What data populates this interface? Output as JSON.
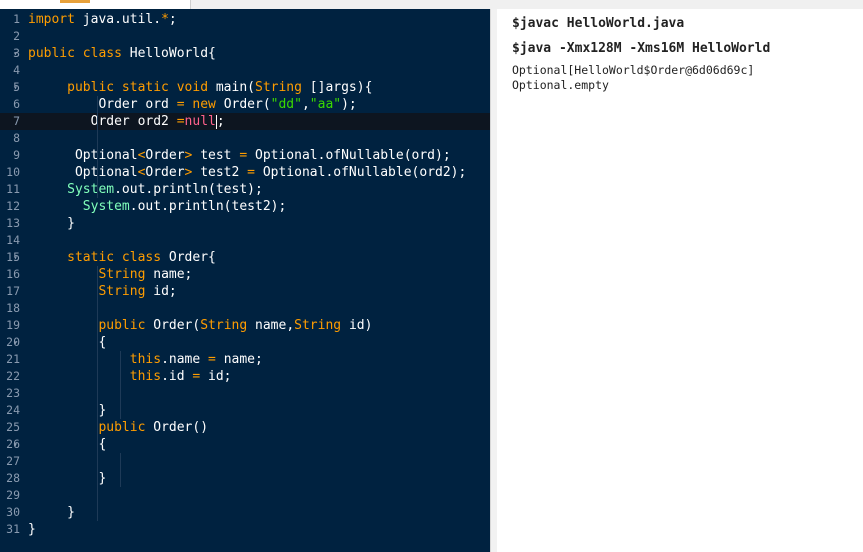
{
  "editor": {
    "lines": [
      {
        "n": "1",
        "fold": false,
        "segs": [
          {
            "t": "import ",
            "c": "kw"
          },
          {
            "t": "java.util.",
            "c": "ident"
          },
          {
            "t": "*",
            "c": "op"
          },
          {
            "t": ";",
            "c": "ident"
          }
        ]
      },
      {
        "n": "2",
        "fold": false,
        "segs": []
      },
      {
        "n": "3",
        "fold": true,
        "segs": [
          {
            "t": "public class ",
            "c": "kw"
          },
          {
            "t": "HelloWorld{",
            "c": "ident"
          }
        ]
      },
      {
        "n": "4",
        "fold": false,
        "segs": []
      },
      {
        "n": "5",
        "fold": true,
        "segs": [
          {
            "t": "     ",
            "c": "ident"
          },
          {
            "t": "public static void ",
            "c": "kw"
          },
          {
            "t": "main(",
            "c": "ident"
          },
          {
            "t": "String",
            "c": "kw"
          },
          {
            "t": " []args){",
            "c": "ident"
          }
        ]
      },
      {
        "n": "6",
        "fold": false,
        "segs": [
          {
            "t": "         Order ord ",
            "c": "ident"
          },
          {
            "t": "= ",
            "c": "op"
          },
          {
            "t": "new ",
            "c": "kw"
          },
          {
            "t": "Order(",
            "c": "ident"
          },
          {
            "t": "\"dd\"",
            "c": "str"
          },
          {
            "t": ",",
            "c": "ident"
          },
          {
            "t": "\"aa\"",
            "c": "str"
          },
          {
            "t": ");",
            "c": "ident"
          }
        ]
      },
      {
        "n": "7",
        "fold": false,
        "active": true,
        "segs": [
          {
            "t": "        Order ord2 ",
            "c": "ident"
          },
          {
            "t": "=",
            "c": "op"
          },
          {
            "t": "null",
            "c": "nul"
          },
          {
            "t": ";",
            "c": "ident",
            "cursor": true
          }
        ]
      },
      {
        "n": "8",
        "fold": false,
        "segs": []
      },
      {
        "n": "9",
        "fold": false,
        "segs": [
          {
            "t": "      Optional",
            "c": "ident"
          },
          {
            "t": "<",
            "c": "op"
          },
          {
            "t": "Order",
            "c": "ident"
          },
          {
            "t": ">",
            "c": "op"
          },
          {
            "t": " test ",
            "c": "ident"
          },
          {
            "t": "= ",
            "c": "op"
          },
          {
            "t": "Optional.ofNullable(ord);",
            "c": "ident"
          }
        ]
      },
      {
        "n": "10",
        "fold": false,
        "segs": [
          {
            "t": "      Optional",
            "c": "ident"
          },
          {
            "t": "<",
            "c": "op"
          },
          {
            "t": "Order",
            "c": "ident"
          },
          {
            "t": ">",
            "c": "op"
          },
          {
            "t": " test2 ",
            "c": "ident"
          },
          {
            "t": "= ",
            "c": "op"
          },
          {
            "t": "Optional.ofNullable(ord2);",
            "c": "ident"
          }
        ]
      },
      {
        "n": "11",
        "fold": false,
        "segs": [
          {
            "t": "     ",
            "c": "ident"
          },
          {
            "t": "System",
            "c": "ty"
          },
          {
            "t": ".out.println(test);",
            "c": "ident"
          }
        ]
      },
      {
        "n": "12",
        "fold": false,
        "segs": [
          {
            "t": "       ",
            "c": "ident"
          },
          {
            "t": "System",
            "c": "ty"
          },
          {
            "t": ".out.println(test2);",
            "c": "ident"
          }
        ]
      },
      {
        "n": "13",
        "fold": false,
        "segs": [
          {
            "t": "     }",
            "c": "ident"
          }
        ]
      },
      {
        "n": "14",
        "fold": false,
        "segs": []
      },
      {
        "n": "15",
        "fold": true,
        "segs": [
          {
            "t": "     ",
            "c": "ident"
          },
          {
            "t": "static class ",
            "c": "kw"
          },
          {
            "t": "Order{",
            "c": "ident"
          }
        ]
      },
      {
        "n": "16",
        "fold": false,
        "segs": [
          {
            "t": "         ",
            "c": "ident"
          },
          {
            "t": "String",
            "c": "kw"
          },
          {
            "t": " name;",
            "c": "ident"
          }
        ]
      },
      {
        "n": "17",
        "fold": false,
        "segs": [
          {
            "t": "         ",
            "c": "ident"
          },
          {
            "t": "String",
            "c": "kw"
          },
          {
            "t": " id;",
            "c": "ident"
          }
        ]
      },
      {
        "n": "18",
        "fold": false,
        "segs": []
      },
      {
        "n": "19",
        "fold": false,
        "segs": [
          {
            "t": "         ",
            "c": "ident"
          },
          {
            "t": "public ",
            "c": "kw"
          },
          {
            "t": "Order(",
            "c": "ident"
          },
          {
            "t": "String",
            "c": "kw"
          },
          {
            "t": " name,",
            "c": "ident"
          },
          {
            "t": "String",
            "c": "kw"
          },
          {
            "t": " id)",
            "c": "ident"
          }
        ]
      },
      {
        "n": "20",
        "fold": true,
        "segs": [
          {
            "t": "         {",
            "c": "ident"
          }
        ]
      },
      {
        "n": "21",
        "fold": false,
        "segs": [
          {
            "t": "             ",
            "c": "ident"
          },
          {
            "t": "this",
            "c": "kw"
          },
          {
            "t": ".name ",
            "c": "ident"
          },
          {
            "t": "= ",
            "c": "op"
          },
          {
            "t": "name;",
            "c": "ident"
          }
        ]
      },
      {
        "n": "22",
        "fold": false,
        "segs": [
          {
            "t": "             ",
            "c": "ident"
          },
          {
            "t": "this",
            "c": "kw"
          },
          {
            "t": ".id ",
            "c": "ident"
          },
          {
            "t": "= ",
            "c": "op"
          },
          {
            "t": "id;",
            "c": "ident"
          }
        ]
      },
      {
        "n": "23",
        "fold": false,
        "segs": []
      },
      {
        "n": "24",
        "fold": false,
        "segs": [
          {
            "t": "         }",
            "c": "ident"
          }
        ]
      },
      {
        "n": "25",
        "fold": false,
        "segs": [
          {
            "t": "         ",
            "c": "ident"
          },
          {
            "t": "public ",
            "c": "kw"
          },
          {
            "t": "Order()",
            "c": "ident"
          }
        ]
      },
      {
        "n": "26",
        "fold": true,
        "segs": [
          {
            "t": "         {",
            "c": "ident"
          }
        ]
      },
      {
        "n": "27",
        "fold": false,
        "segs": []
      },
      {
        "n": "28",
        "fold": false,
        "segs": [
          {
            "t": "         }",
            "c": "ident"
          }
        ]
      },
      {
        "n": "29",
        "fold": false,
        "segs": []
      },
      {
        "n": "30",
        "fold": false,
        "segs": [
          {
            "t": "     }",
            "c": "ident"
          }
        ]
      },
      {
        "n": "31",
        "fold": false,
        "segs": [
          {
            "t": "}",
            "c": "ident"
          }
        ]
      }
    ]
  },
  "output": {
    "compile_cmd": "$javac HelloWorld.java",
    "run_cmd": "$java -Xmx128M -Xms16M HelloWorld",
    "lines": [
      "Optional[HelloWorld$Order@6d06d69c]",
      "Optional.empty"
    ]
  },
  "fold_glyph": "▾"
}
